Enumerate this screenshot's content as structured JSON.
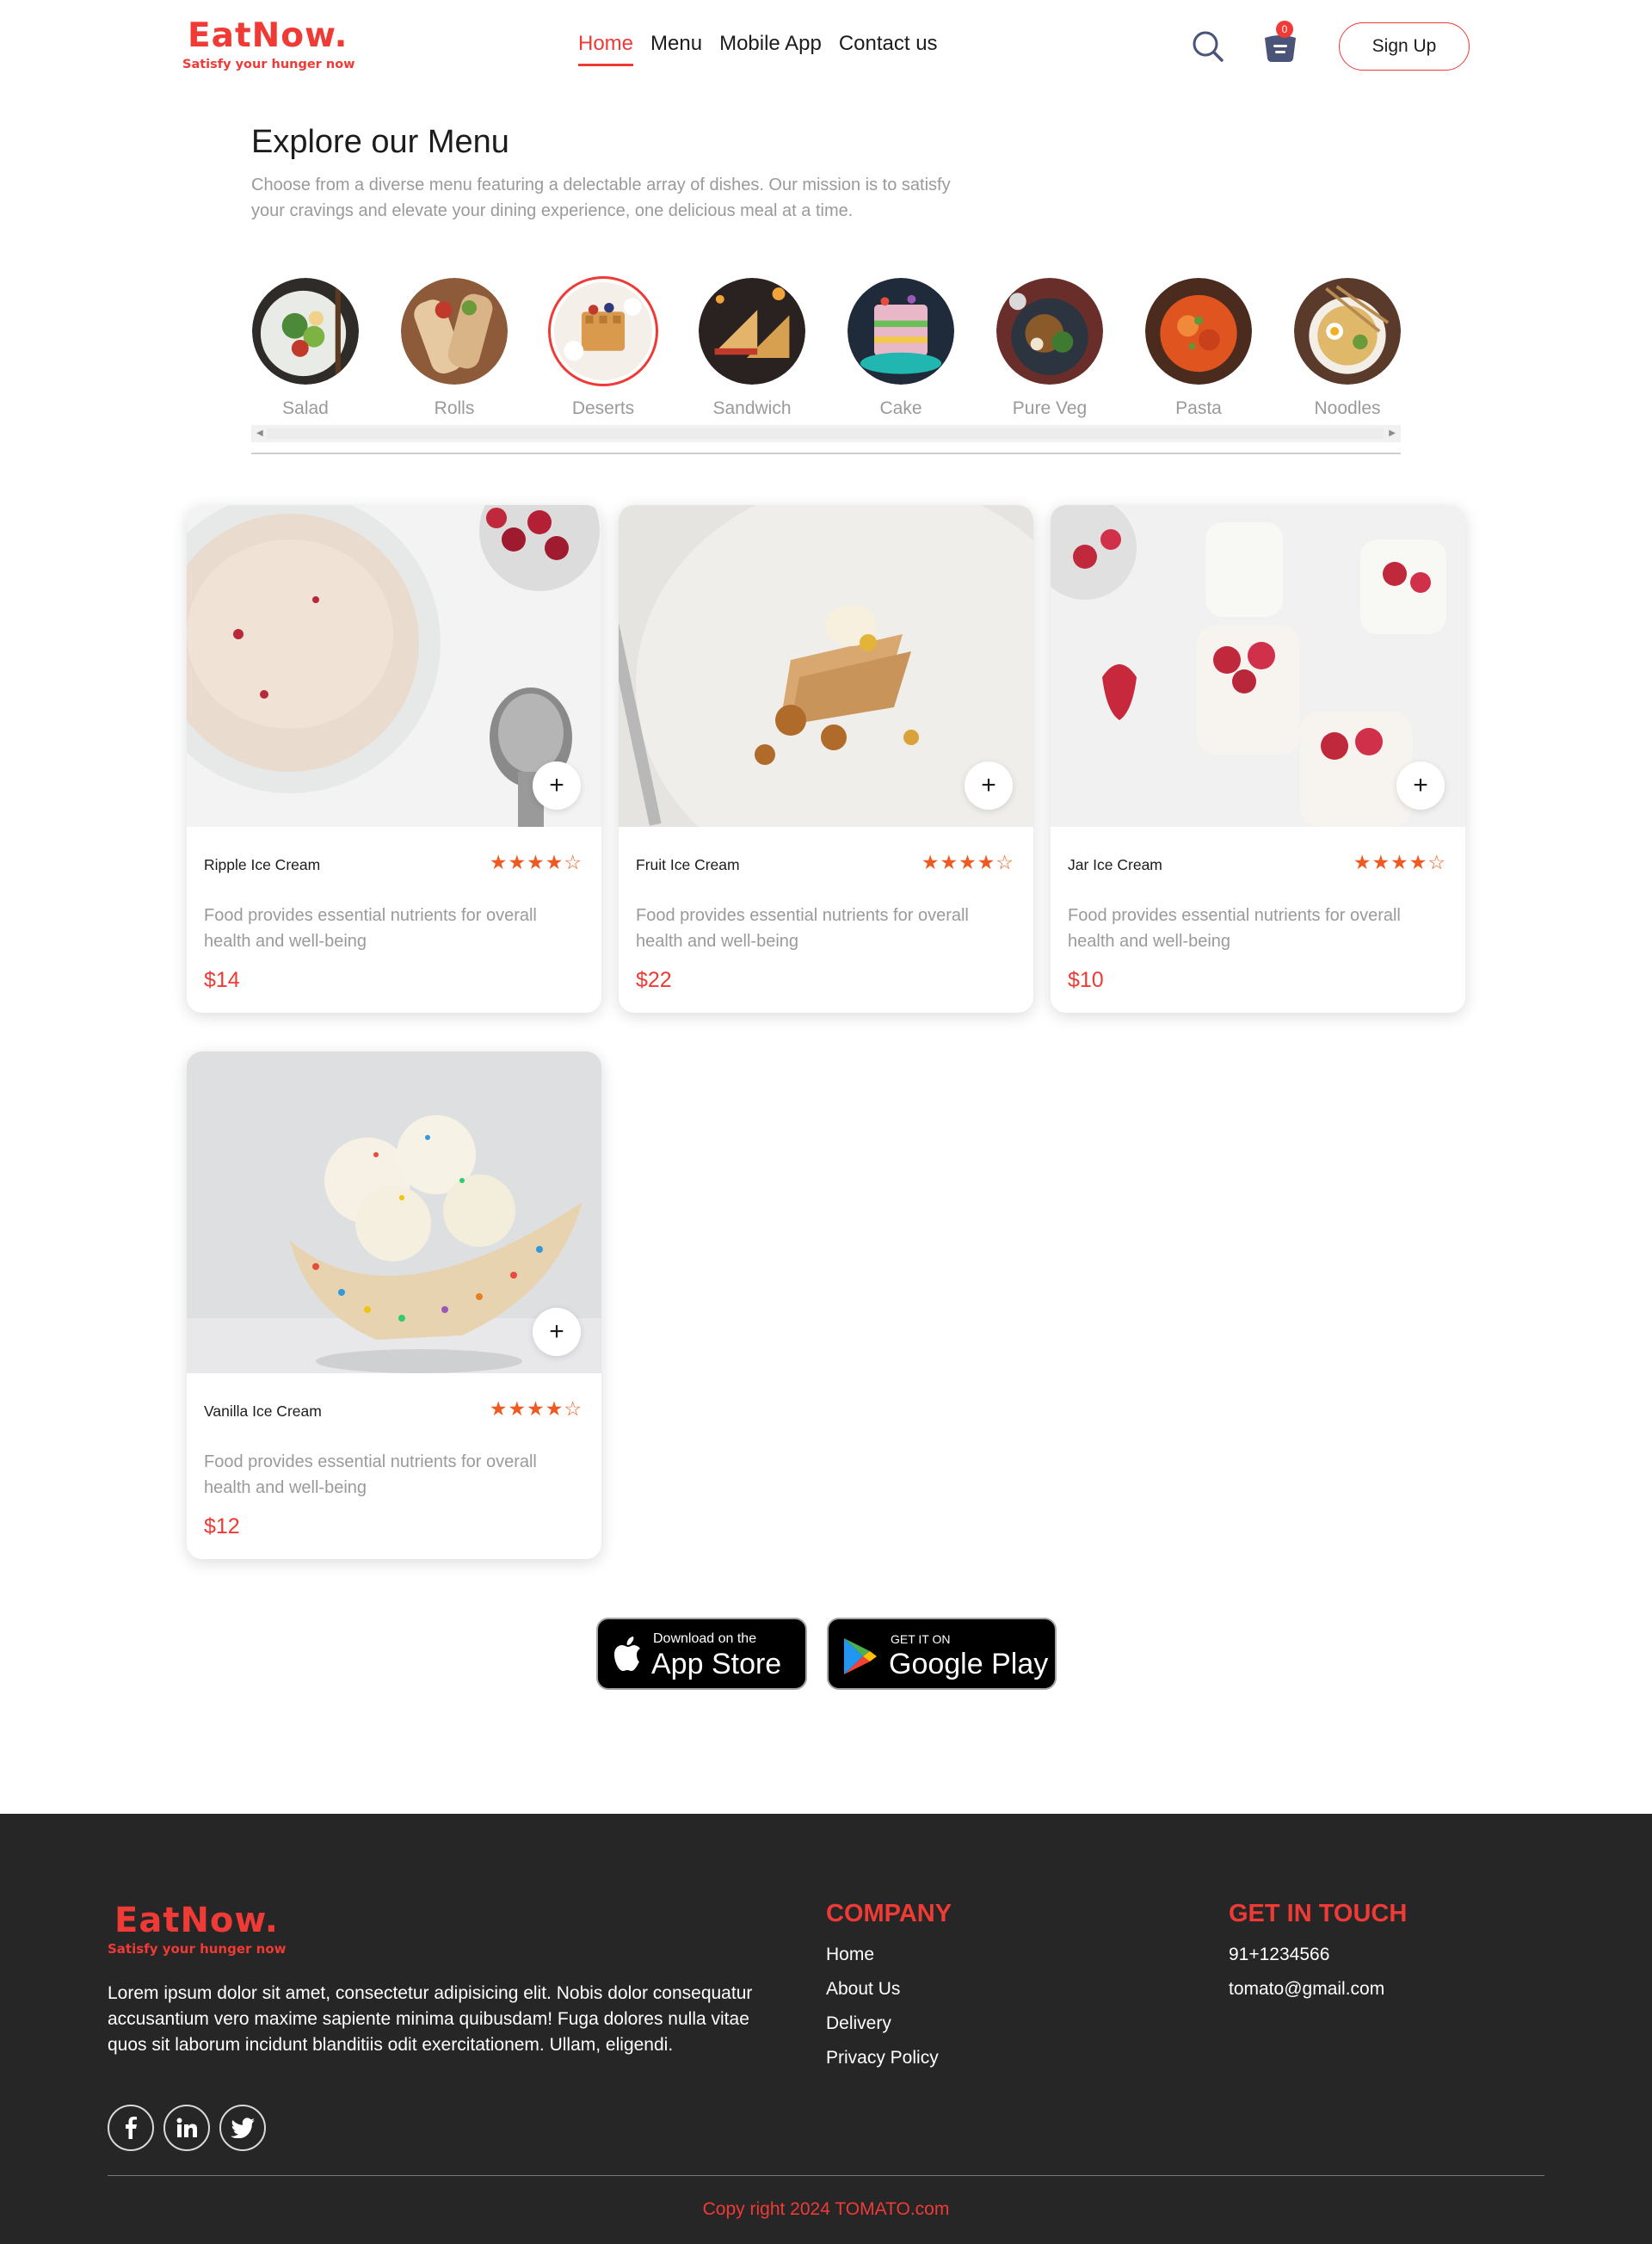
{
  "brand": {
    "name": "EatNow.",
    "tagline": "Satisfy your hunger now"
  },
  "nav": {
    "items": [
      "Home",
      "Menu",
      "Mobile App",
      "Contact us"
    ],
    "active": "Home"
  },
  "cart": {
    "count": "0"
  },
  "signup_label": "Sign Up",
  "explore": {
    "title": "Explore our Menu",
    "description": "Choose from a diverse menu featuring a delectable array of dishes. Our mission is to satisfy your cravings and elevate your dining experience, one delicious meal at a time.",
    "categories": [
      "Salad",
      "Rolls",
      "Deserts",
      "Sandwich",
      "Cake",
      "Pure Veg",
      "Pasta",
      "Noodles"
    ],
    "selected": "Deserts"
  },
  "foods": [
    {
      "name": "Ripple Ice Cream",
      "rating": 4,
      "stars": "★★★★☆",
      "description": "Food provides essential nutrients for overall health and well-being",
      "price": "$14"
    },
    {
      "name": "Fruit Ice Cream",
      "rating": 4,
      "stars": "★★★★☆",
      "description": "Food provides essential nutrients for overall health and well-being",
      "price": "$22"
    },
    {
      "name": "Jar Ice Cream",
      "rating": 4,
      "stars": "★★★★☆",
      "description": "Food provides essential nutrients for overall health and well-being",
      "price": "$10"
    },
    {
      "name": "Vanilla Ice Cream",
      "rating": 4,
      "stars": "★★★★☆",
      "description": "Food provides essential nutrients for overall health and well-being",
      "price": "$12"
    }
  ],
  "add_label": "+",
  "app_store": {
    "small": "Download on the",
    "big": "App Store"
  },
  "google_play": {
    "small": "GET IT ON",
    "big": "Google Play"
  },
  "footer": {
    "about": "Lorem ipsum dolor sit amet, consectetur adipisicing elit. Nobis dolor consequatur accusantium vero maxime sapiente minima quibusdam! Fuga dolores nulla vitae quos sit laborum incidunt blanditiis odit exercitationem. Ullam, eligendi.",
    "company_title": "COMPANY",
    "company_links": [
      "Home",
      "About Us",
      "Delivery",
      "Privacy Policy"
    ],
    "contact_title": "GET IN TOUCH",
    "phone": "91+1234566",
    "email": "tomato@gmail.com",
    "social_icons": [
      "facebook-icon",
      "linkedin-icon",
      "twitter-icon"
    ],
    "copyright": "Copy right 2024 TOMATO.com"
  },
  "colors": {
    "accent": "#ef3a36",
    "star": "#ef5a22",
    "footer_bg": "#262626",
    "muted_text": "#9a9a9a"
  }
}
